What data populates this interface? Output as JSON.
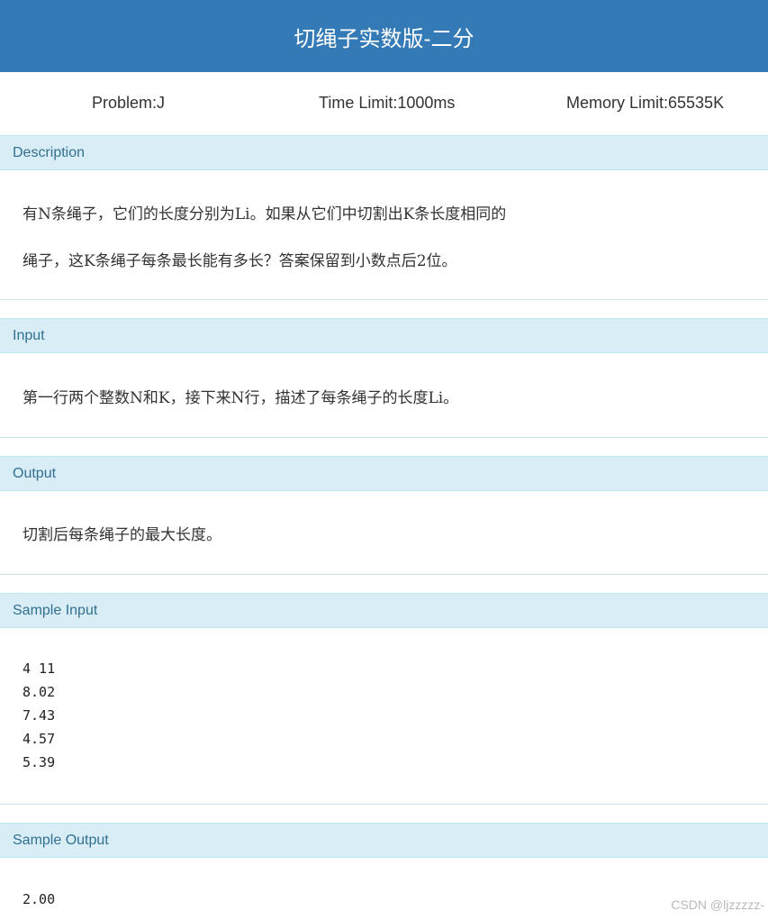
{
  "header": {
    "title": "切绳子实数版-二分"
  },
  "meta": {
    "problem": "Problem:J",
    "time_limit": "Time Limit:1000ms",
    "memory_limit": "Memory Limit:65535K"
  },
  "sections": {
    "description": {
      "heading": "Description",
      "lines": [
        "有N条绳子，它们的长度分别为Li。如果从它们中切割出K条长度相同的",
        "绳子，这K条绳子每条最长能有多长？答案保留到小数点后2位。"
      ]
    },
    "input": {
      "heading": "Input",
      "text": "第一行两个整数N和K，接下来N行，描述了每条绳子的长度Li。"
    },
    "output": {
      "heading": "Output",
      "text": "切割后每条绳子的最大长度。"
    },
    "sample_input": {
      "heading": "Sample Input",
      "text": "4 11\n8.02\n7.43\n4.57\n5.39"
    },
    "sample_output": {
      "heading": "Sample Output",
      "text": "2.00"
    }
  },
  "watermark": "CSDN @ljzzzzz-",
  "colors": {
    "title_bar": "#337ab7",
    "panel_heading_bg": "#d9edf7",
    "panel_heading_text": "#31708f"
  }
}
